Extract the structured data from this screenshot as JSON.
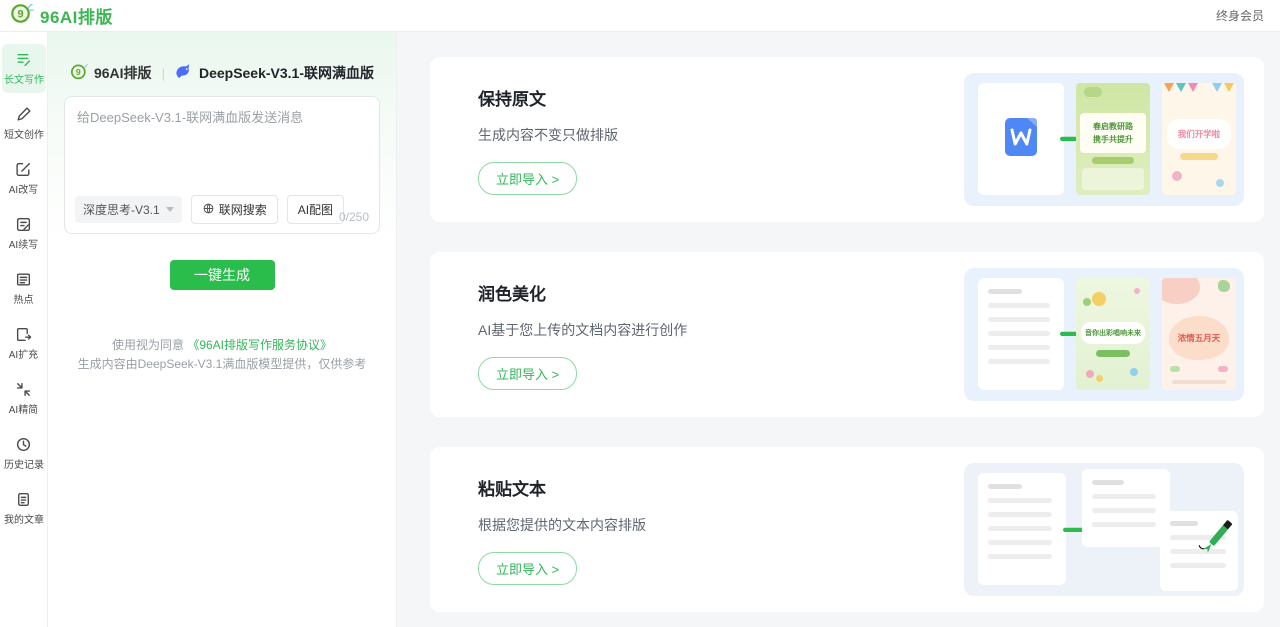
{
  "colors": {
    "accent": "#35b558",
    "button_green": "#2abd4c",
    "deepseek_blue": "#4d6bfe",
    "word_blue": "#4f87f5"
  },
  "header": {
    "brand": "96AI排版",
    "member": "终身会员"
  },
  "sidebar": {
    "items": [
      {
        "label": "长文写作"
      },
      {
        "label": "短文创作"
      },
      {
        "label": "AI改写"
      },
      {
        "label": "AI续写"
      },
      {
        "label": "热点"
      },
      {
        "label": "AI扩充"
      },
      {
        "label": "AI精简"
      },
      {
        "label": "历史记录"
      },
      {
        "label": "我的文章"
      }
    ]
  },
  "composer": {
    "brand": "96AI排版",
    "divider": "|",
    "model_name": "DeepSeek-V3.1-联网满血版",
    "placeholder": "给DeepSeek-V3.1-联网满血版发送消息",
    "model_select": "深度思考-V3.1",
    "web_search": "联网搜索",
    "ai_image": "AI配图",
    "char_count": "0/250",
    "generate": "一键生成",
    "agree_prefix": "使用视为同意 ",
    "agree_link": "《96AI排版写作服务协议》",
    "disclaimer": "生成内容由DeepSeek-V3.1满血版模型提供，仅供参考"
  },
  "cards": [
    {
      "title": "保持原文",
      "desc": "生成内容不变只做排版",
      "cta": "立即导入 >",
      "posters": {
        "a_line1": "春启教研路",
        "a_line2": "携手共提升",
        "b_line1": "我们开学啦"
      }
    },
    {
      "title": "润色美化",
      "desc": "AI基于您上传的文档内容进行创作",
      "cta": "立即导入 >",
      "posters": {
        "a_line1": "音你出彩唱响未来",
        "b_line1": "浓情五月天"
      }
    },
    {
      "title": "粘贴文本",
      "desc": "根据您提供的文本内容排版",
      "cta": "立即导入 >"
    }
  ]
}
